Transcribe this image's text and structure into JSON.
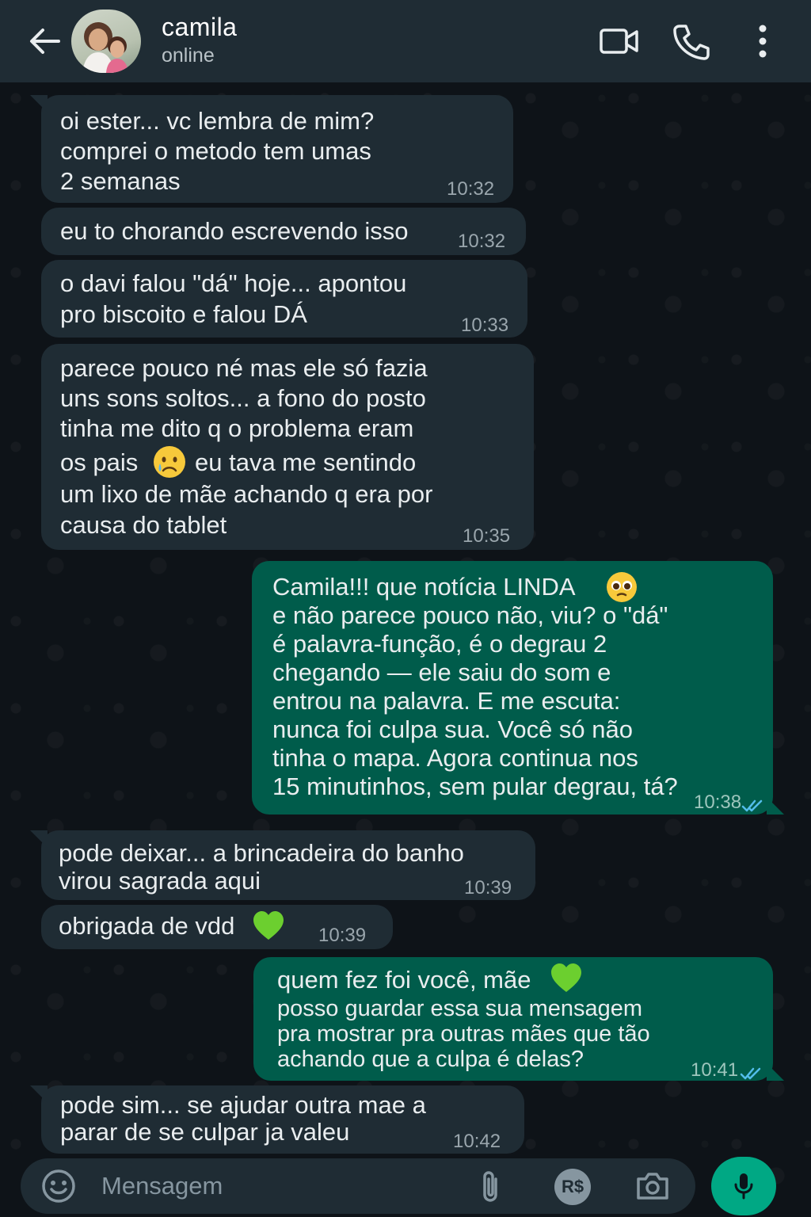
{
  "header": {
    "contact_name": "camila",
    "status": "online",
    "icons": [
      "back-arrow-icon",
      "avatar",
      "video-call-icon",
      "phone-call-icon",
      "more-vert-icon"
    ]
  },
  "messages": [
    {
      "direction": "in",
      "lines": [
        "oi ester... vc lembra de mim?",
        "comprei o metodo tem umas",
        "2 semanas"
      ],
      "time": "10:32"
    },
    {
      "direction": "in",
      "lines": [
        "eu to chorando escrevendo isso"
      ],
      "time": "10:32"
    },
    {
      "direction": "in",
      "lines": [
        "o davi falou \"dá\" hoje... apontou",
        "pro biscoito e falou DÁ"
      ],
      "time": "10:33"
    },
    {
      "direction": "in",
      "lines": [
        "parece pouco né mas ele só fazia",
        "uns sons soltos... a fono do posto",
        "tinha me dito q o problema eram",
        "os pais",
        "eu tava me sentindo",
        "um lixo de mãe achando q era por",
        "causa do tablet"
      ],
      "time": "10:35",
      "emoji": "crying-face"
    },
    {
      "direction": "out",
      "lines": [
        "Camila!!! que notícia LINDA",
        "e não parece pouco não, viu? o \"dá\"",
        "é palavra-função, é o degrau 2",
        "chegando — ele saiu do som e",
        "entrou na palavra. E me escuta:",
        "nunca foi culpa sua. Você só não",
        "tinha o mapa. Agora continua nos",
        "15 minutinhos, sem pular degrau, tá?"
      ],
      "time": "10:38",
      "emoji": "pleading-face",
      "status": "read"
    },
    {
      "direction": "in",
      "lines": [
        "pode deixar... a brincadeira do banho",
        "virou sagrada aqui"
      ],
      "time": "10:39"
    },
    {
      "direction": "in",
      "lines": [
        "obrigada de vdd"
      ],
      "time": "10:39",
      "emoji": "green-heart"
    },
    {
      "direction": "out",
      "lines": [
        "quem fez foi você, mãe",
        "posso guardar essa sua mensagem",
        "pra mostrar pra outras mães que tão",
        "achando que a culpa é delas?"
      ],
      "time": "10:41",
      "emoji": "green-heart",
      "status": "read"
    },
    {
      "direction": "in",
      "lines": [
        "pode sim... se ajudar outra mae a",
        "parar de se culpar ja valeu"
      ],
      "time": "10:42"
    }
  ],
  "input": {
    "placeholder": "Mensagem",
    "pay_label": "R$"
  },
  "colors": {
    "header_bg": "#1f2c34",
    "incoming_bubble": "#1f2c34",
    "outgoing_bubble": "#005c4b",
    "read_ticks": "#53bdeb",
    "mic_button": "#00a884"
  }
}
